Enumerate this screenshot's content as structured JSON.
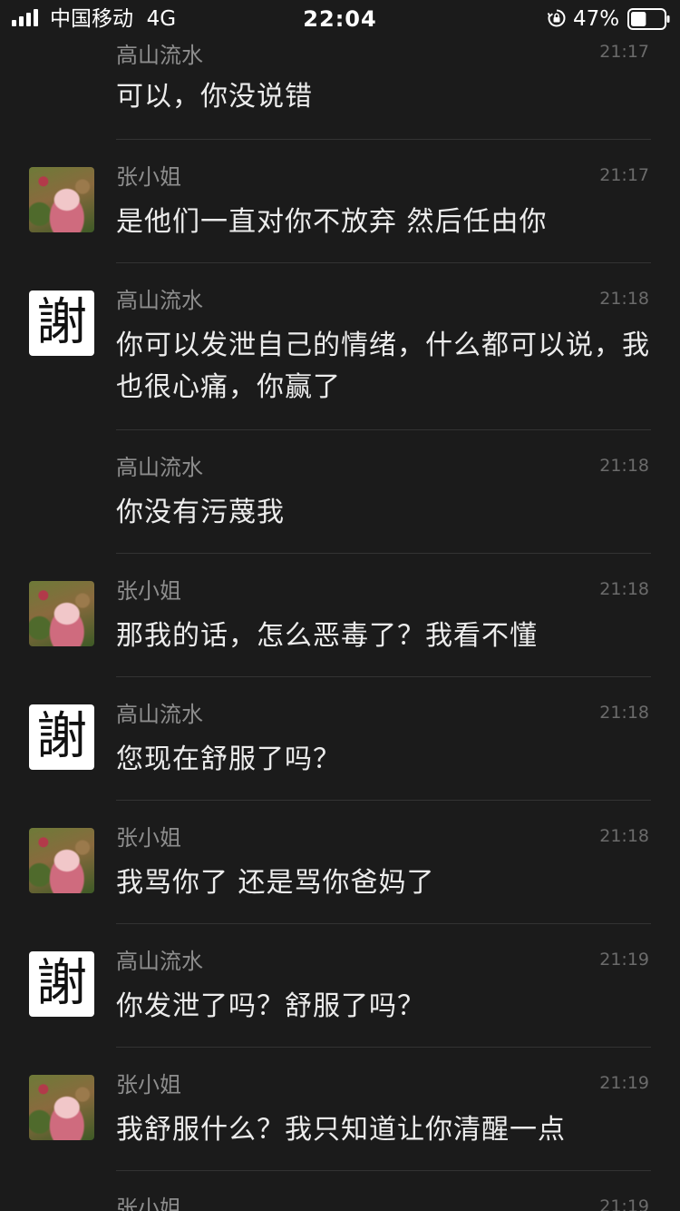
{
  "status_bar": {
    "carrier": "中国移动",
    "network": "4G",
    "time": "22:04",
    "battery_percent": "47%",
    "battery_level": 0.47
  },
  "messages": [
    {
      "sender": "高山流水",
      "time": "21:17",
      "text": "可以，你没说错",
      "avatar": "none"
    },
    {
      "sender": "张小姐",
      "time": "21:17",
      "text": "是他们一直对你不放弃  然后任由你",
      "avatar": "photo"
    },
    {
      "sender": "高山流水",
      "time": "21:18",
      "text": "你可以发泄自己的情绪，什么都可以说，我也很心痛，你赢了",
      "avatar": "xie"
    },
    {
      "sender": "高山流水",
      "time": "21:18",
      "text": "你没有污蔑我",
      "avatar": "none"
    },
    {
      "sender": "张小姐",
      "time": "21:18",
      "text": "那我的话，怎么恶毒了？我看不懂",
      "avatar": "photo"
    },
    {
      "sender": "高山流水",
      "time": "21:18",
      "text": "您现在舒服了吗？",
      "avatar": "xie"
    },
    {
      "sender": "张小姐",
      "time": "21:18",
      "text": "我骂你了  还是骂你爸妈了",
      "avatar": "photo"
    },
    {
      "sender": "高山流水",
      "time": "21:19",
      "text": "你发泄了吗？舒服了吗？",
      "avatar": "xie"
    },
    {
      "sender": "张小姐",
      "time": "21:19",
      "text": "我舒服什么？我只知道让你清醒一点",
      "avatar": "photo"
    },
    {
      "sender": "张小姐",
      "time": "21:19",
      "text": "",
      "avatar": "none"
    }
  ],
  "avatar_glyph": "謝",
  "icons": {
    "signal": "signal-bars-icon",
    "orientation_lock": "orientation-lock-icon",
    "battery": "battery-icon"
  },
  "colors": {
    "background": "#1b1b1b",
    "text": "#ececec",
    "sender": "#8d8d8d",
    "time": "#6b6b6b",
    "divider": "#333333"
  }
}
